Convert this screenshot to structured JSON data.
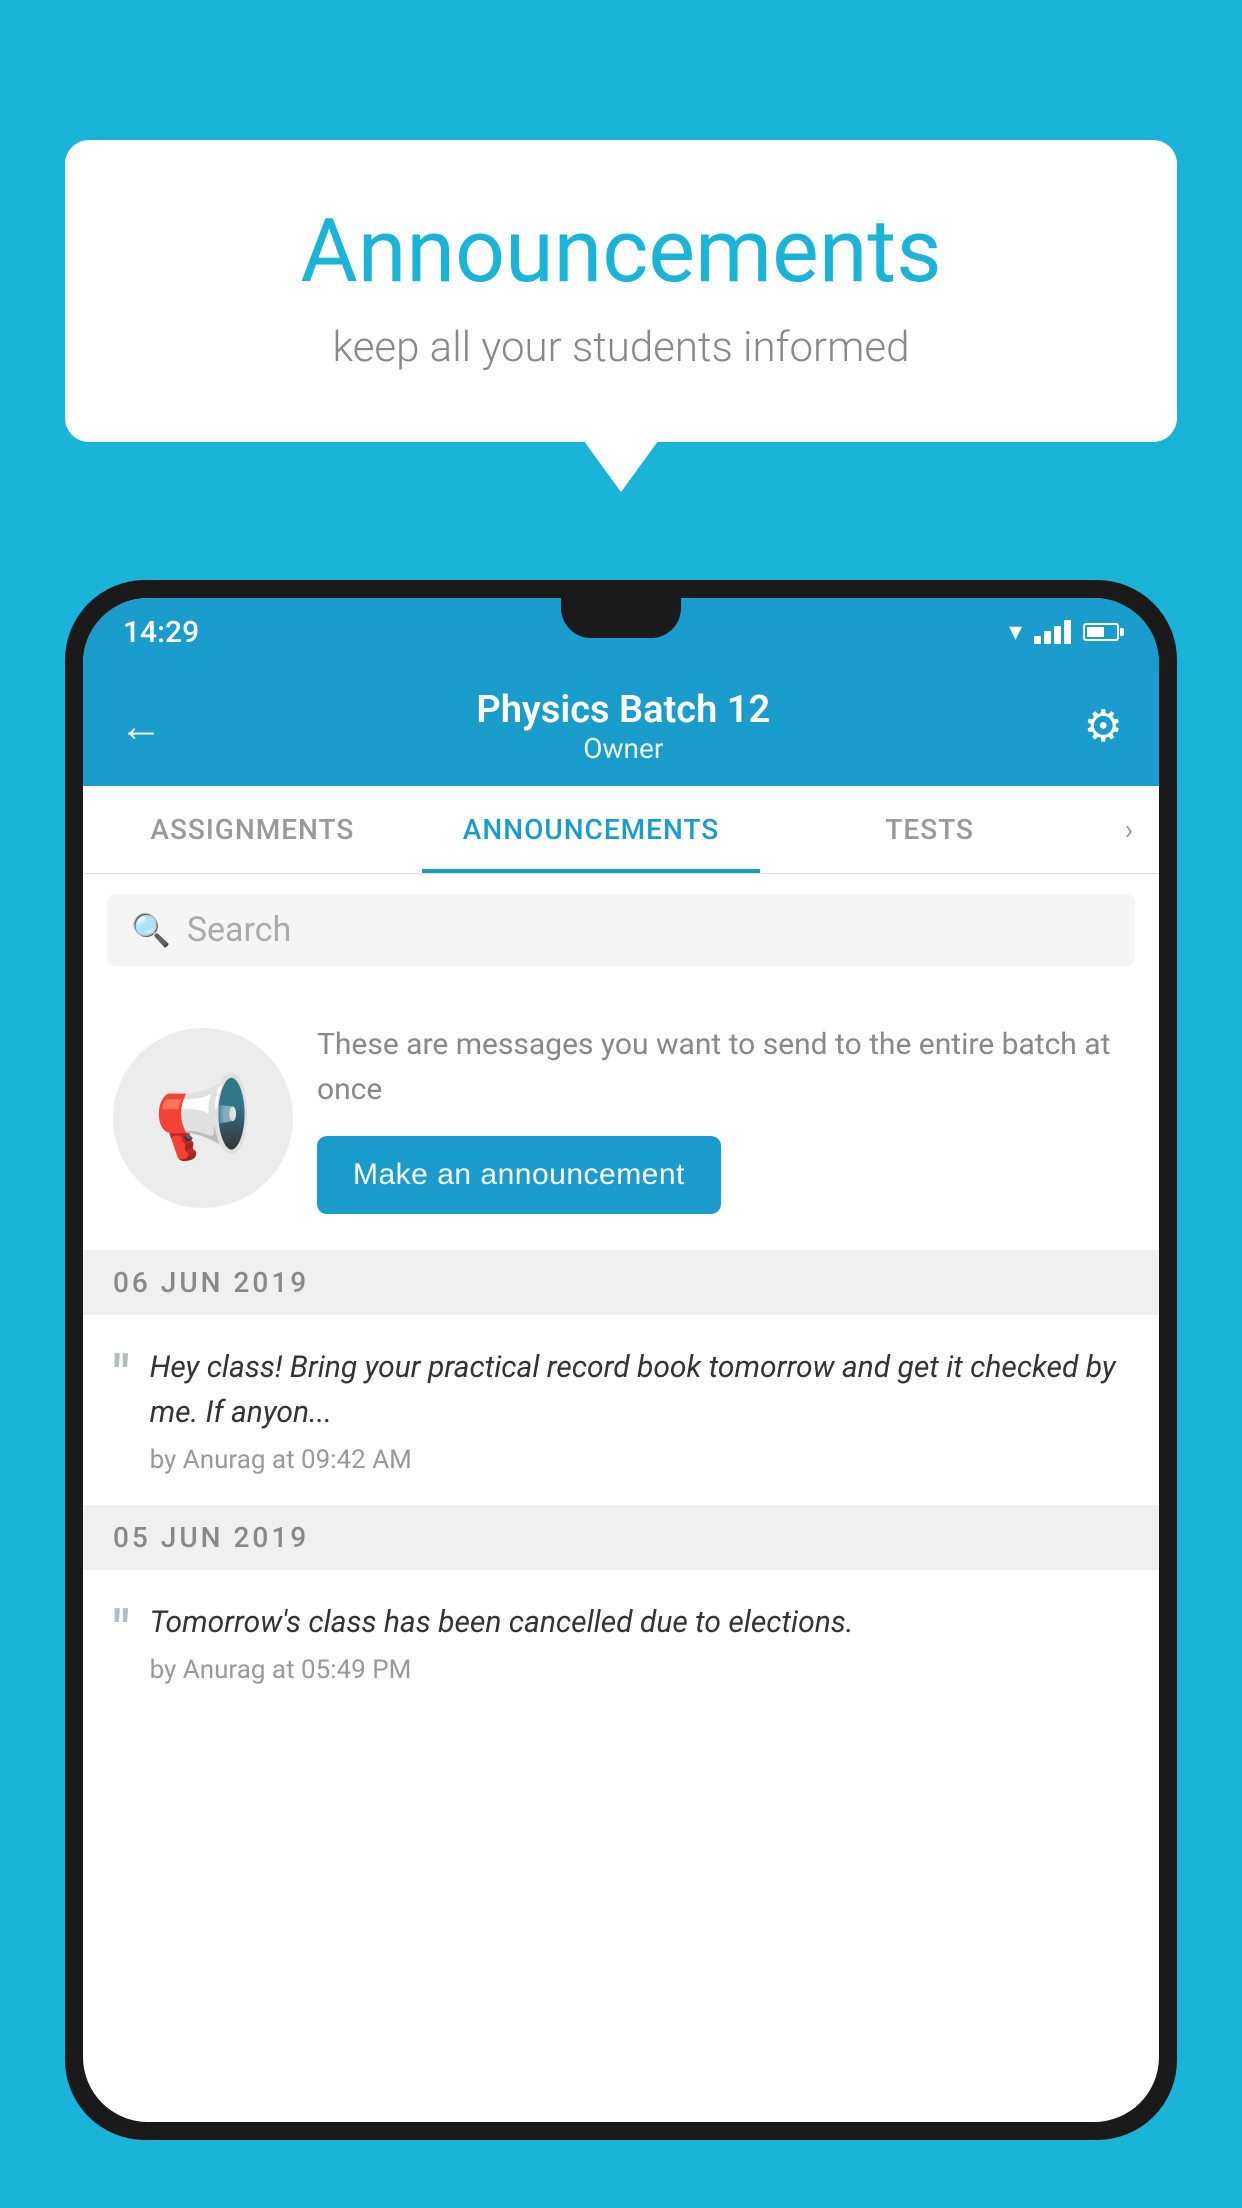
{
  "background_color": "#1ab4d8",
  "speech_bubble": {
    "title": "Announcements",
    "subtitle": "keep all your students informed"
  },
  "phone": {
    "status_bar": {
      "time": "14:29"
    },
    "header": {
      "title": "Physics Batch 12",
      "subtitle": "Owner",
      "back_label": "←",
      "gear_label": "⚙"
    },
    "tabs": [
      {
        "label": "ASSIGNMENTS",
        "active": false
      },
      {
        "label": "ANNOUNCEMENTS",
        "active": true
      },
      {
        "label": "TESTS",
        "active": false
      }
    ],
    "search": {
      "placeholder": "Search"
    },
    "promo": {
      "text": "These are messages you want to send to the entire batch at once",
      "button_label": "Make an announcement"
    },
    "announcements": [
      {
        "date": "06  JUN  2019",
        "text": "Hey class! Bring your practical record book tomorrow and get it checked by me. If anyon...",
        "meta": "by Anurag at 09:42 AM"
      },
      {
        "date": "05  JUN  2019",
        "text": "Tomorrow's class has been cancelled due to elections.",
        "meta": "by Anurag at 05:49 PM"
      }
    ]
  }
}
